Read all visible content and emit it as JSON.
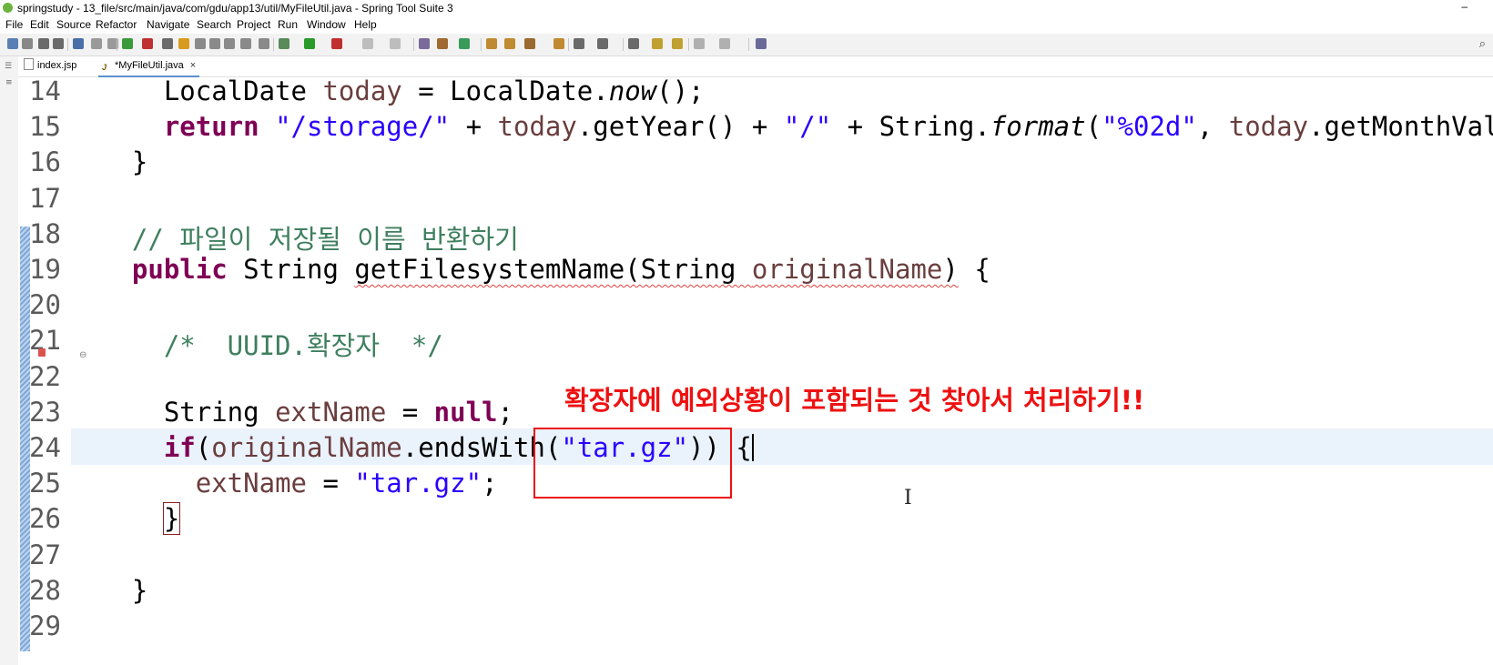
{
  "window": {
    "title": "springstudy - 13_file/src/main/java/com/gdu/app13/util/MyFileUtil.java - Spring Tool Suite 3",
    "minimize_glyph": "–"
  },
  "menu": [
    "File",
    "Edit",
    "Source",
    "Refactor",
    "Navigate",
    "Search",
    "Project",
    "Run",
    "Window",
    "Help"
  ],
  "toolbar": {
    "search_icon": "search-icon"
  },
  "tabs": [
    {
      "label": "index.jsp",
      "icon": "file-icon",
      "active": false
    },
    {
      "label": "*MyFileUtil.java",
      "icon": "java-file-icon",
      "active": true,
      "close": "×"
    }
  ],
  "editor": {
    "lines": [
      {
        "num": "14",
        "segments": [
          {
            "t": "    LocalDate "
          },
          {
            "t": "today",
            "c": "fld"
          },
          {
            "t": " = LocalDate."
          },
          {
            "t": "now",
            "c": "it"
          },
          {
            "t": "();"
          }
        ]
      },
      {
        "num": "15",
        "segments": [
          {
            "t": "    "
          },
          {
            "t": "return",
            "c": "kw"
          },
          {
            "t": " "
          },
          {
            "t": "\"/storage/\"",
            "c": "str"
          },
          {
            "t": " + "
          },
          {
            "t": "today",
            "c": "fld"
          },
          {
            "t": ".getYear() + "
          },
          {
            "t": "\"/\"",
            "c": "str"
          },
          {
            "t": " + String."
          },
          {
            "t": "format",
            "c": "it"
          },
          {
            "t": "("
          },
          {
            "t": "\"%02d\"",
            "c": "str"
          },
          {
            "t": ", "
          },
          {
            "t": "today",
            "c": "fld"
          },
          {
            "t": ".getMonthVal"
          }
        ]
      },
      {
        "num": "16",
        "segments": [
          {
            "t": "  }"
          }
        ]
      },
      {
        "num": "17",
        "segments": []
      },
      {
        "num": "18",
        "segments": [
          {
            "t": "  // 파일이 저장될 이름 반환하기",
            "c": "cm"
          }
        ]
      },
      {
        "num": "19",
        "segments": [
          {
            "t": "  "
          },
          {
            "t": "public",
            "c": "kw"
          },
          {
            "t": " String "
          },
          {
            "t": "getFilesystemName(String ",
            "c": "squig"
          },
          {
            "t": "originalName",
            "c": "fld squig"
          },
          {
            "t": ")",
            "c": "squig"
          },
          {
            "t": " {"
          }
        ]
      },
      {
        "num": "20",
        "segments": []
      },
      {
        "num": "21",
        "segments": [
          {
            "t": "    /*  UUID.확장자  */",
            "c": "cm"
          }
        ]
      },
      {
        "num": "22",
        "segments": []
      },
      {
        "num": "23",
        "segments": [
          {
            "t": "    String "
          },
          {
            "t": "extName",
            "c": "fld"
          },
          {
            "t": " = "
          },
          {
            "t": "null",
            "c": "kw"
          },
          {
            "t": ";"
          }
        ]
      },
      {
        "num": "24",
        "segments": [
          {
            "t": "    "
          },
          {
            "t": "if",
            "c": "kw"
          },
          {
            "t": "("
          },
          {
            "t": "originalName",
            "c": "fld"
          },
          {
            "t": ".endsWith("
          },
          {
            "t": "\"tar.gz\"",
            "c": "str"
          },
          {
            "t": ")) {"
          }
        ]
      },
      {
        "num": "25",
        "segments": [
          {
            "t": "      "
          },
          {
            "t": "extName",
            "c": "fld"
          },
          {
            "t": " = "
          },
          {
            "t": "\"tar.gz\"",
            "c": "str"
          },
          {
            "t": ";"
          }
        ]
      },
      {
        "num": "26",
        "segments": [
          {
            "t": "    "
          },
          {
            "t": "}",
            "c": "bracket"
          }
        ]
      },
      {
        "num": "27",
        "segments": []
      },
      {
        "num": "28",
        "segments": [
          {
            "t": "  }"
          }
        ]
      },
      {
        "num": "29",
        "segments": []
      }
    ]
  },
  "annotation": {
    "text": "확장자에 예외상황이 포함되는 것 찾아서 처리하기!!",
    "color": "#ee1111"
  },
  "colors": {
    "keyword": "#7f0055",
    "string": "#2a00ff",
    "comment": "#3f7f5f",
    "field": "#6a3e3e",
    "current_line": "#eaf2fc"
  }
}
